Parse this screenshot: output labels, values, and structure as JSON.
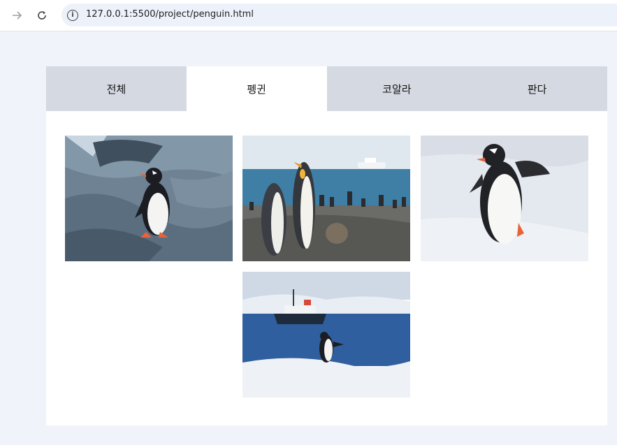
{
  "browser": {
    "url": "127.0.0.1:5500/project/penguin.html"
  },
  "tabs": [
    {
      "label": "전체",
      "active": false
    },
    {
      "label": "펭귄",
      "active": true
    },
    {
      "label": "코알라",
      "active": false
    },
    {
      "label": "판다",
      "active": false
    }
  ],
  "gallery": {
    "photos": [
      {
        "subject": "penguin-on-rock"
      },
      {
        "subject": "king-penguins-beach"
      },
      {
        "subject": "penguin-walking-snow"
      },
      {
        "subject": "penguin-ship-sea"
      }
    ]
  },
  "colors": {
    "page_bg": "#f0f4fa",
    "tab_inactive": "#d4d9e2",
    "tab_active": "#ffffff"
  }
}
